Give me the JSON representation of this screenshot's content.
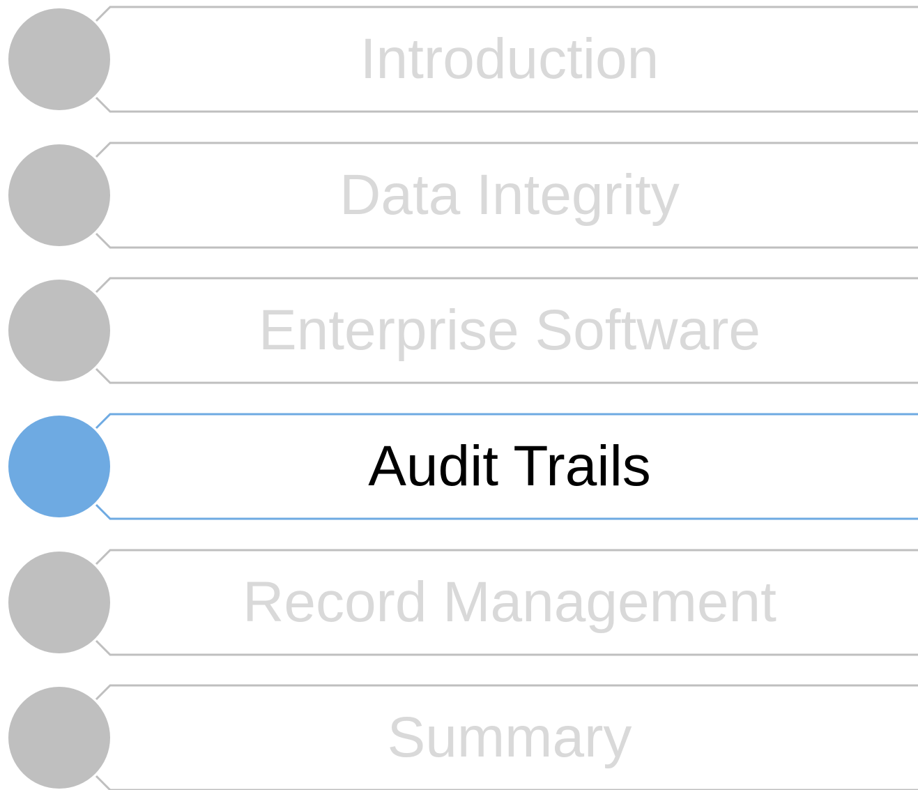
{
  "agenda": {
    "items": [
      {
        "label": "Introduction",
        "active": false
      },
      {
        "label": "Data Integrity",
        "active": false
      },
      {
        "label": "Enterprise Software",
        "active": false
      },
      {
        "label": "Audit Trails",
        "active": true
      },
      {
        "label": "Record Management",
        "active": false
      },
      {
        "label": "Summary",
        "active": false
      }
    ]
  },
  "colors": {
    "inactive_shape": "#bfbfbf",
    "inactive_text": "#d9d9d9",
    "active_shape": "#6eaae2",
    "active_text": "#000000"
  }
}
